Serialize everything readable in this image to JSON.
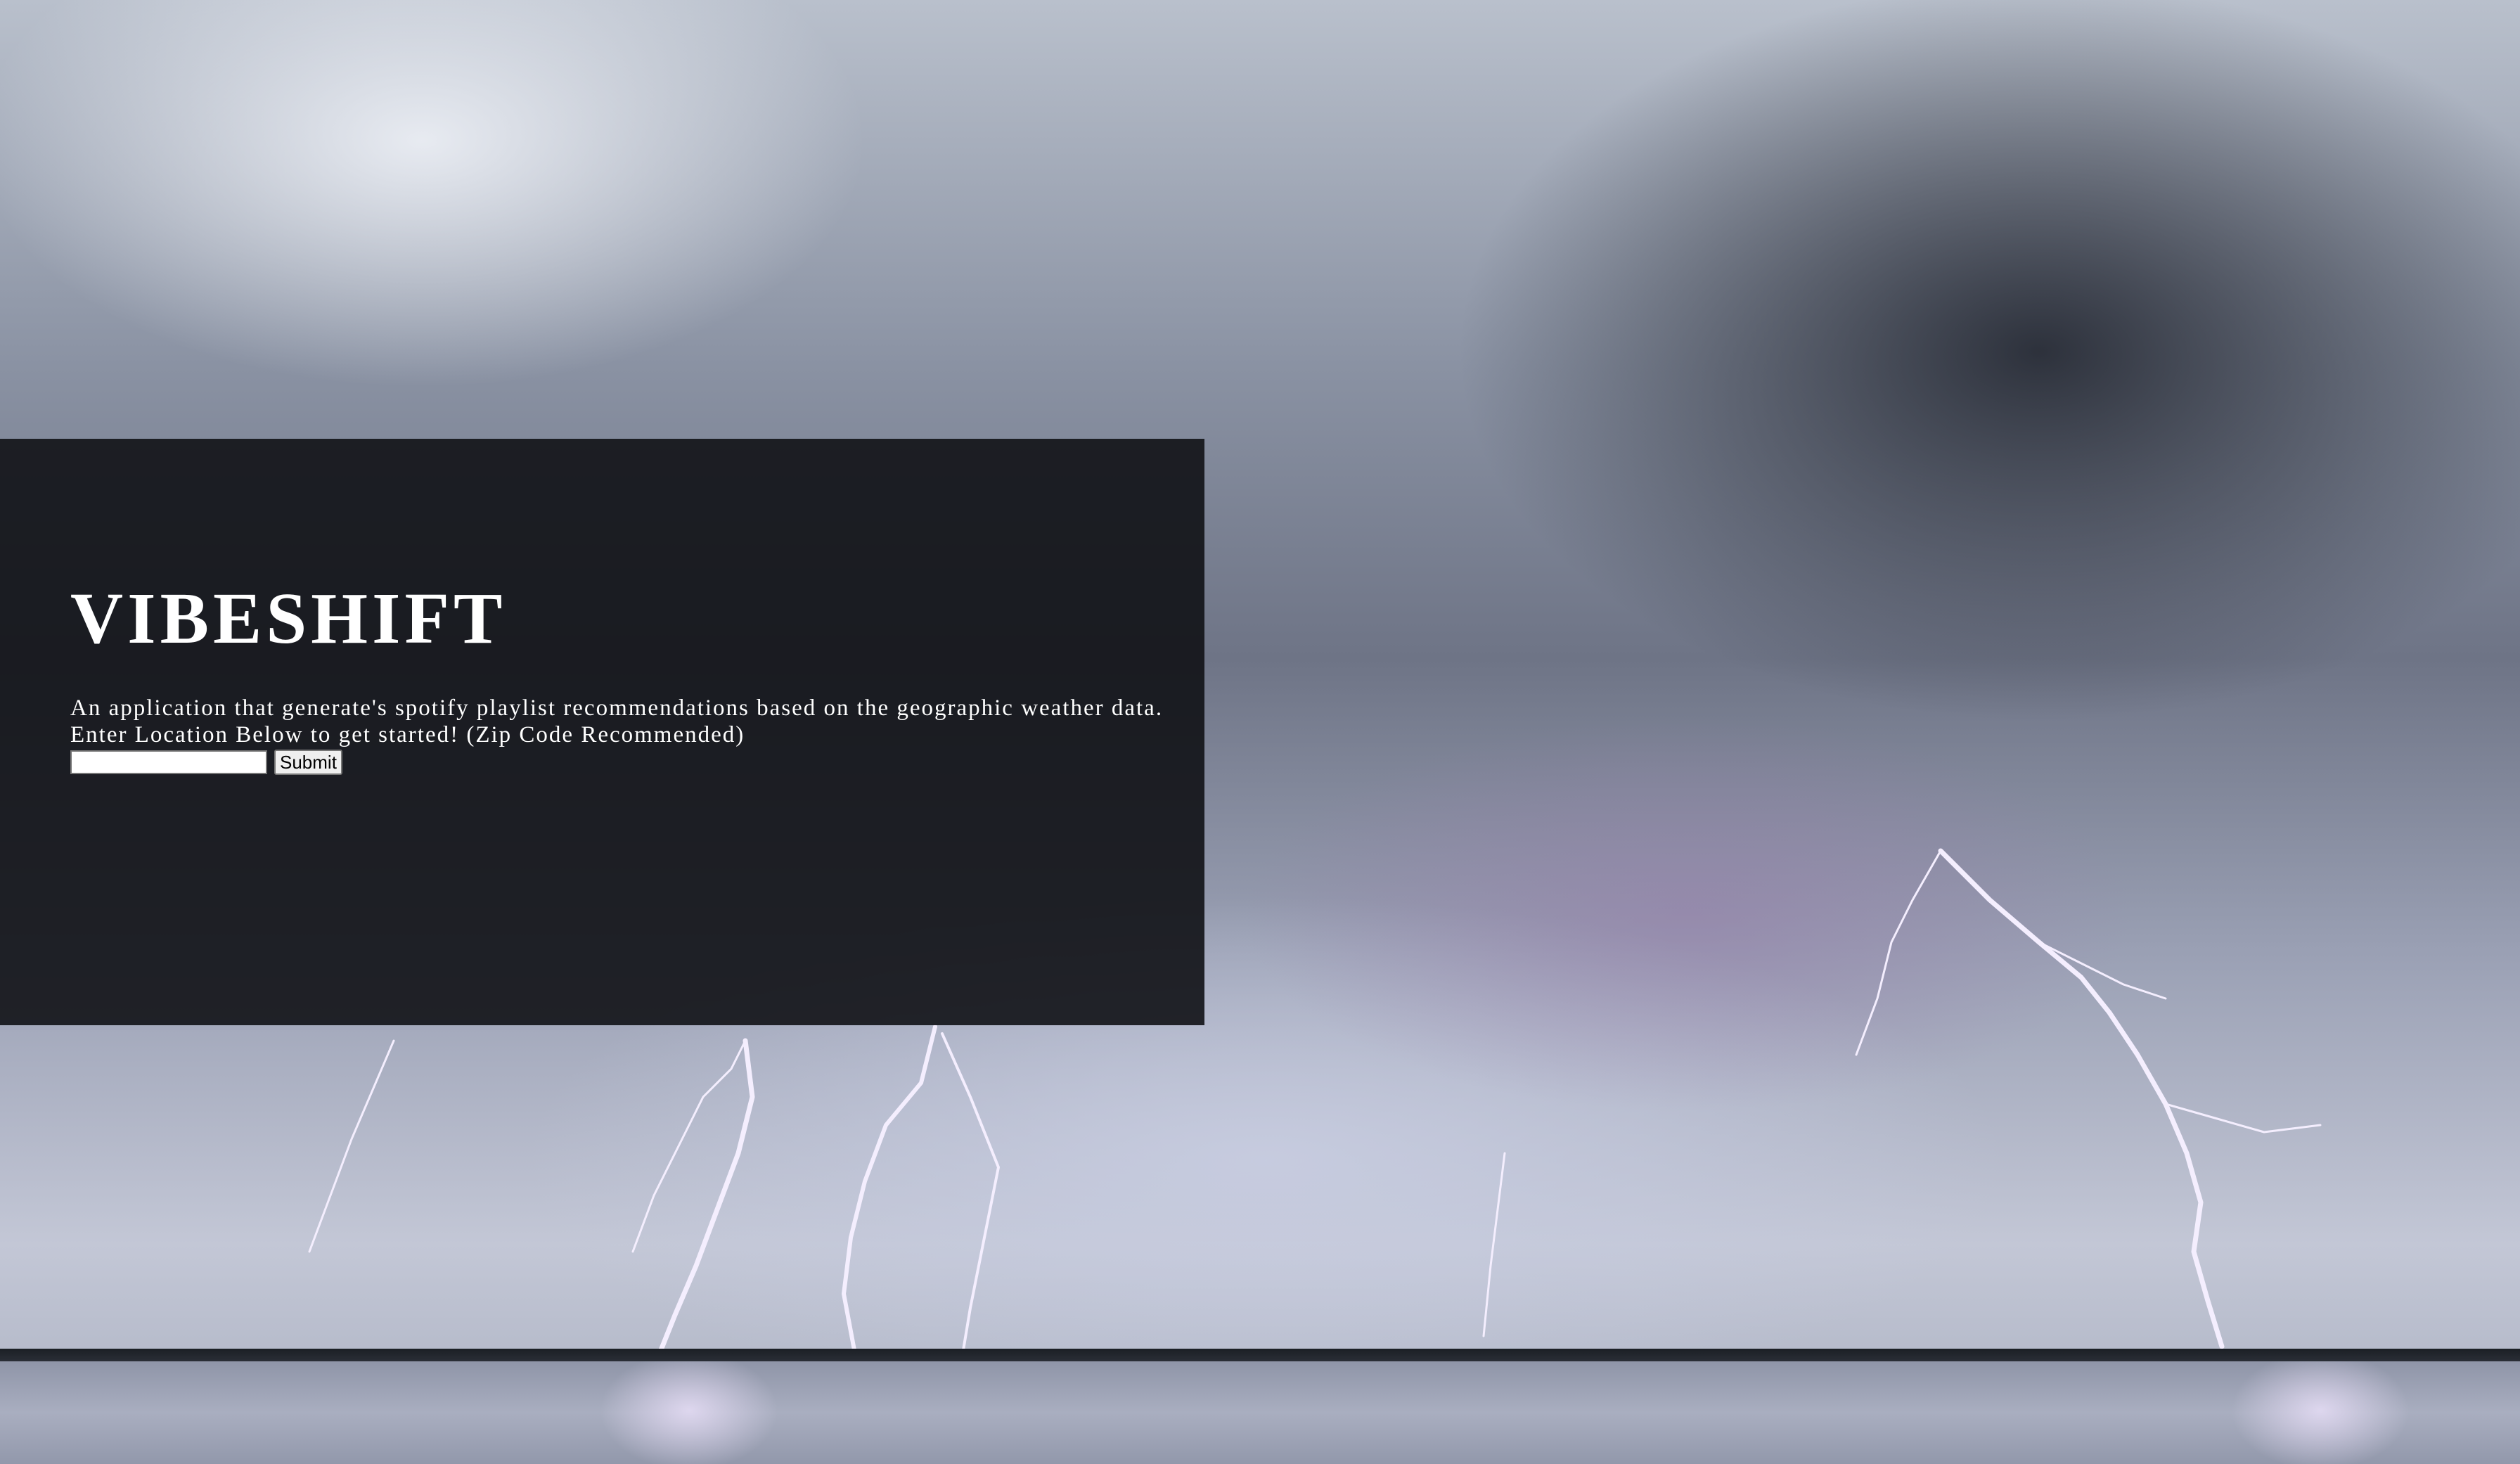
{
  "background": {
    "scene": "lightning-storm-over-water"
  },
  "hero": {
    "title": "VIBESHIFT",
    "description": "An application that generate's spotify playlist recommendations based on the geographic weather data.",
    "instruction": "Enter Location Below to get started! (Zip Code Recommended)"
  },
  "form": {
    "input_value": "",
    "input_placeholder": "",
    "submit_label": "Submit"
  },
  "colors": {
    "panel": "#111216",
    "text": "#ffffff"
  }
}
